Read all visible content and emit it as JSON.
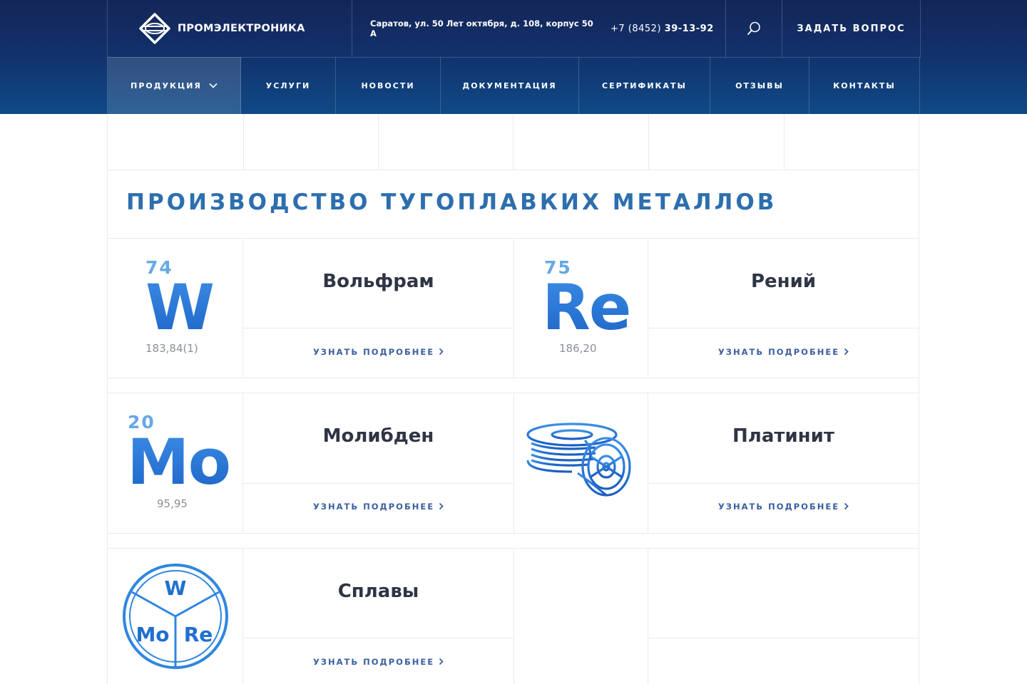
{
  "header": {
    "logo_text": "ПРОМЭЛЕКТРОНИКА",
    "address": "Саратов, ул. 50 Лет октября, д. 108, корпус 50 А",
    "phone_code": "+7 (8452)",
    "phone_number": "39-13-92",
    "ask_label": "ЗАДАТЬ ВОПРОС",
    "colors": {
      "bg_top": "#142658",
      "bg_bottom": "#0f4a86"
    }
  },
  "nav": {
    "items": [
      {
        "label": "ПРОДУКЦИЯ",
        "active": true
      },
      {
        "label": "УСЛУГИ"
      },
      {
        "label": "НОВОСТИ"
      },
      {
        "label": "ДОКУМЕНТАЦИЯ"
      },
      {
        "label": "СЕРТИФИКАТЫ"
      },
      {
        "label": "ОТЗЫВЫ"
      },
      {
        "label": "КОНТАКТЫ"
      }
    ]
  },
  "page": {
    "title": "ПРОИЗВОДСТВО ТУГОПЛАВКИХ МЕТАЛЛОВ",
    "accent_color": "#2d6fae"
  },
  "products": [
    {
      "name": "Вольфрам",
      "link": "УЗНАТЬ ПОДРОБНЕЕ",
      "element": {
        "number": "74",
        "symbol": "W",
        "mass": "183,84(1)"
      }
    },
    {
      "name": "Рений",
      "link": "УЗНАТЬ ПОДРОБНЕЕ",
      "element": {
        "number": "75",
        "symbol": "Re",
        "mass": "186,20"
      }
    },
    {
      "name": "Молибден",
      "link": "УЗНАТЬ ПОДРОБНЕЕ",
      "element": {
        "number": "20",
        "symbol": "Mo",
        "mass": "95,95"
      }
    },
    {
      "name": "Платинит",
      "link": "УЗНАТЬ ПОДРОБНЕЕ",
      "icon": "wire-spool-icon"
    },
    {
      "name": "Сплавы",
      "link": "УЗНАТЬ ПОДРОБНЕЕ",
      "icon": "alloy-circle-icon",
      "alloy_labels": [
        "W",
        "Mo",
        "Re"
      ]
    }
  ]
}
